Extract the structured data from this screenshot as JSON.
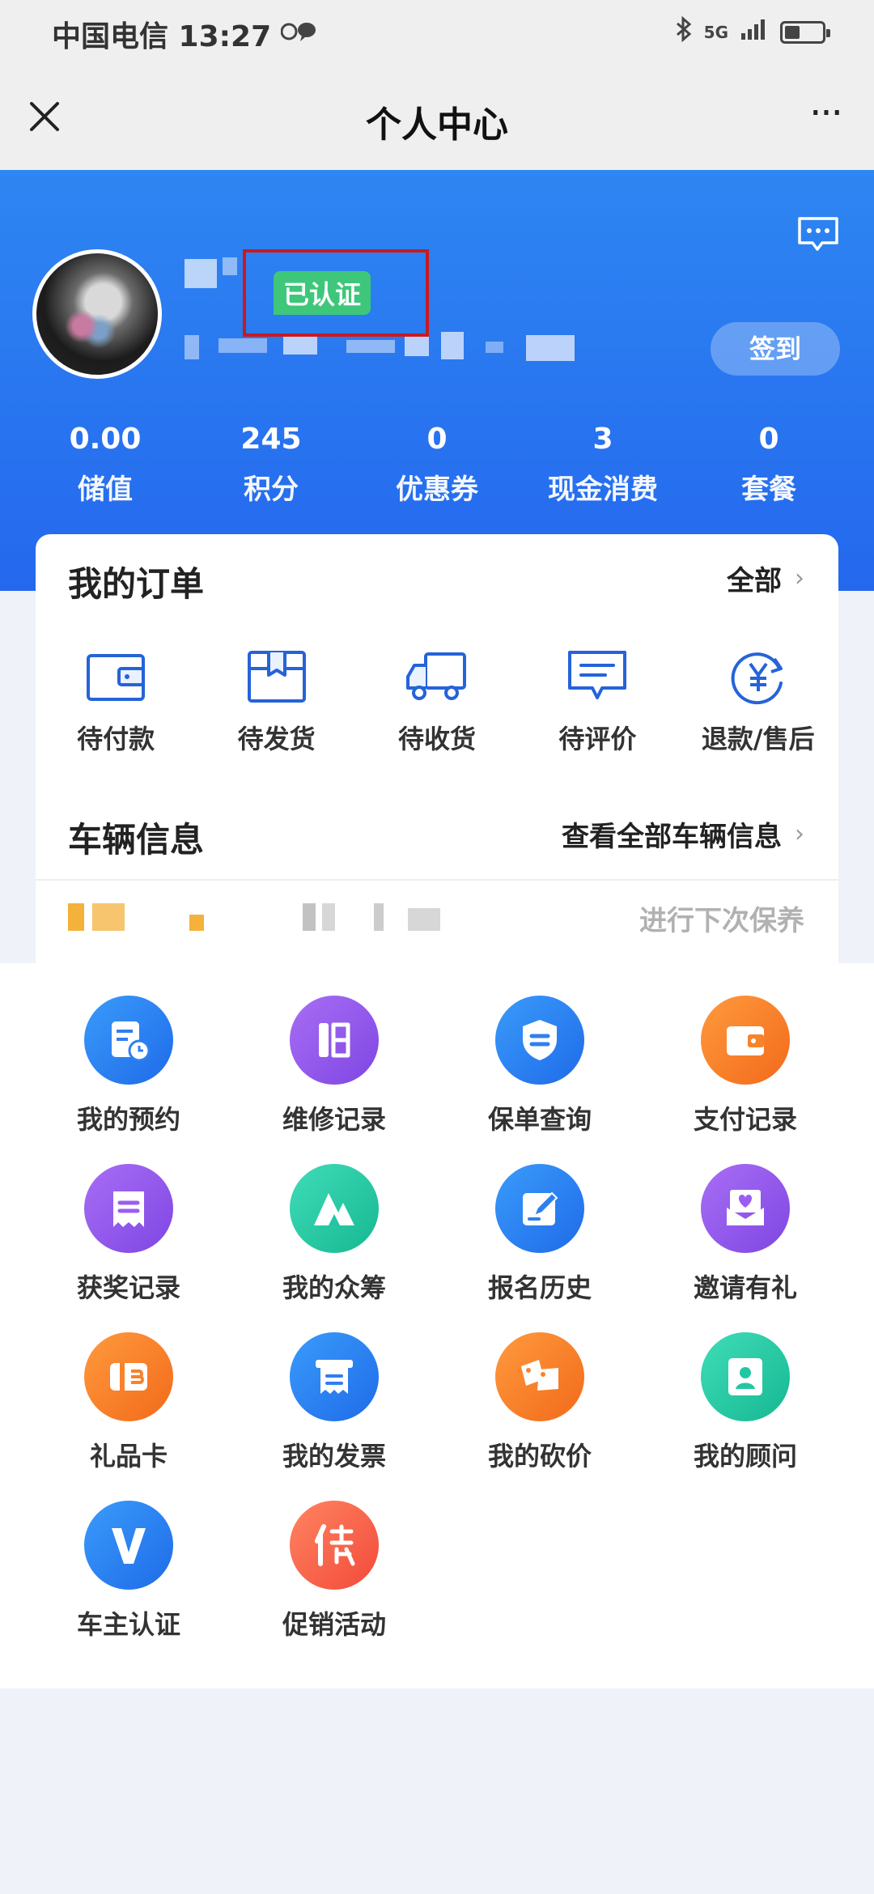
{
  "status_bar": {
    "carrier_time": "中国电信 13:27",
    "network": "5G"
  },
  "nav": {
    "title": "个人中心",
    "more": "···"
  },
  "profile": {
    "verified_badge": "已认证",
    "signin_label": "签到"
  },
  "stats": [
    {
      "value": "0.00",
      "label": "储值"
    },
    {
      "value": "245",
      "label": "积分"
    },
    {
      "value": "0",
      "label": "优惠券"
    },
    {
      "value": "3",
      "label": "现金消费"
    },
    {
      "value": "0",
      "label": "套餐"
    }
  ],
  "orders": {
    "title": "我的订单",
    "more": "全部",
    "items": [
      {
        "label": "待付款",
        "icon": "wallet-icon"
      },
      {
        "label": "待发货",
        "icon": "box-icon"
      },
      {
        "label": "待收货",
        "icon": "truck-icon"
      },
      {
        "label": "待评价",
        "icon": "comment-icon"
      },
      {
        "label": "退款/售后",
        "icon": "refund-yen-icon"
      }
    ]
  },
  "vehicle": {
    "title": "车辆信息",
    "more": "查看全部车辆信息",
    "note": "进行下次保养"
  },
  "services": [
    {
      "label": "我的预约",
      "icon": "appointment-icon",
      "color": "#2f86f2"
    },
    {
      "label": "维修记录",
      "icon": "repair-record-icon",
      "color": "#9a5ef0"
    },
    {
      "label": "保单查询",
      "icon": "policy-shield-icon",
      "color": "#2f86f2"
    },
    {
      "label": "支付记录",
      "icon": "wallet-icon",
      "color": "#f7832b"
    },
    {
      "label": "获奖记录",
      "icon": "award-record-icon",
      "color": "#9a5ef0"
    },
    {
      "label": "我的众筹",
      "icon": "crowdfunding-icon",
      "color": "#22c7a2"
    },
    {
      "label": "报名历史",
      "icon": "signup-edit-icon",
      "color": "#2f86f2"
    },
    {
      "label": "邀请有礼",
      "icon": "invite-gift-icon",
      "color": "#9a5ef0"
    },
    {
      "label": "礼品卡",
      "icon": "gift-card-icon",
      "color": "#f7832b"
    },
    {
      "label": "我的发票",
      "icon": "invoice-icon",
      "color": "#2f86f2"
    },
    {
      "label": "我的砍价",
      "icon": "bargain-tag-icon",
      "color": "#f7832b"
    },
    {
      "label": "我的顾问",
      "icon": "advisor-contact-icon",
      "color": "#22c7a2"
    },
    {
      "label": "车主认证",
      "icon": "owner-verify-v-icon",
      "color": "#2f86f2"
    },
    {
      "label": "促销活动",
      "icon": "promotion-icon",
      "color": "#f35a43"
    }
  ]
}
